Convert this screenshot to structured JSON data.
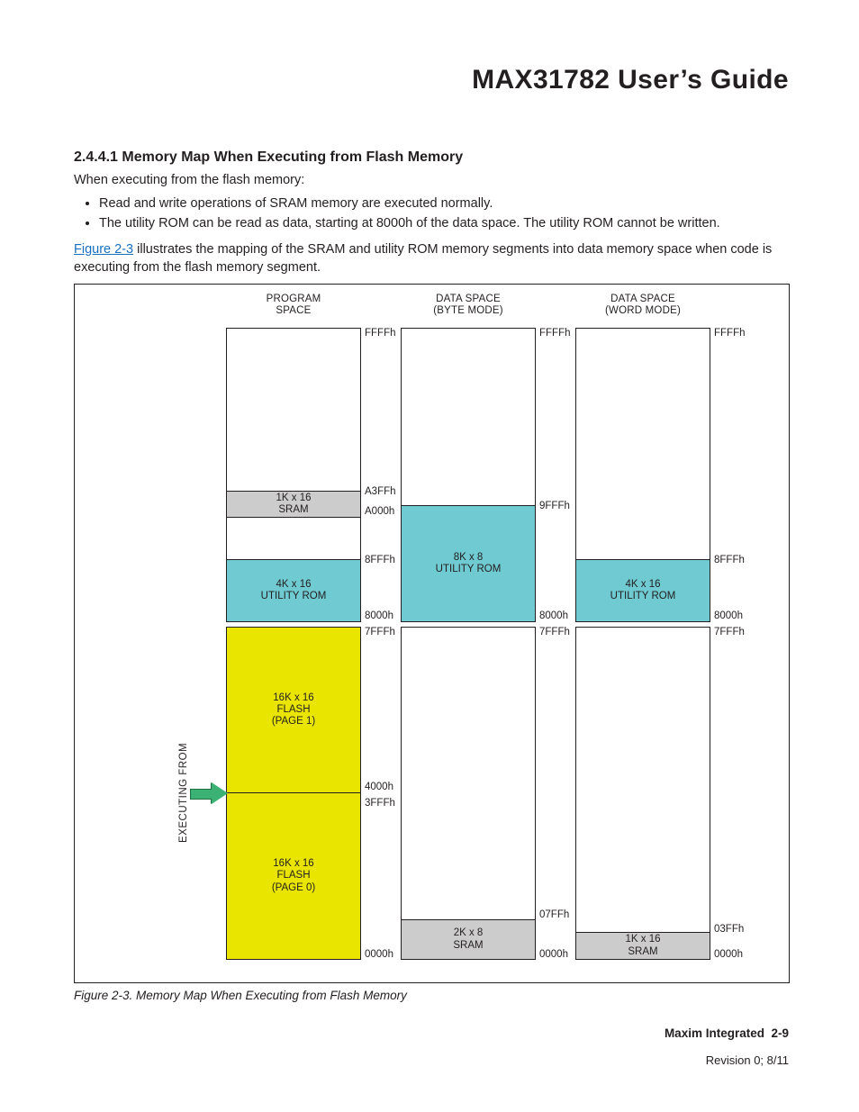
{
  "header": {
    "title": "MAX31782 User’s Guide"
  },
  "section": {
    "number": "2.4.4.1",
    "title": "Memory Map When Executing from Flash Memory",
    "intro": "When executing from the flash memory:",
    "bullets": [
      "Read and write operations of SRAM memory are executed normally.",
      "The utility ROM can be read as data, starting at 8000h of the data space. The utility ROM cannot be written."
    ],
    "para_link": "Figure 2-3",
    "para_rest": " illustrates the mapping of the SRAM and utility ROM memory segments into data memory space when code is executing from the flash memory segment."
  },
  "figure": {
    "caption": "Figure 2-3. Memory Map When Executing from Flash Memory",
    "exec_label": "EXECUTING FROM",
    "columns": {
      "prog": {
        "label_l1": "PROGRAM",
        "label_l2": "SPACE"
      },
      "byte": {
        "label_l1": "DATA SPACE",
        "label_l2": "(BYTE MODE)"
      },
      "word": {
        "label_l1": "DATA SPACE",
        "label_l2": "(WORD MODE)"
      }
    },
    "prog": {
      "addr_FFFF": "FFFFh",
      "sram_l1": "1K x 16",
      "sram_l2": "SRAM",
      "addr_A3FF": "A3FFh",
      "addr_A000": "A000h",
      "urom_l1": "4K x 16",
      "urom_l2": "UTILITY ROM",
      "addr_8FFF": "8FFFh",
      "addr_8000": "8000h",
      "addr_7FFF": "7FFFh",
      "flash1_l1": "16K x 16",
      "flash1_l2": "FLASH",
      "flash1_l3": "(PAGE 1)",
      "addr_4000": "4000h",
      "addr_3FFF": "3FFFh",
      "flash0_l1": "16K x 16",
      "flash0_l2": "FLASH",
      "flash0_l3": "(PAGE 0)",
      "addr_0000": "0000h"
    },
    "byte": {
      "addr_FFFF": "FFFFh",
      "addr_9FFF": "9FFFh",
      "urom_l1": "8K x 8",
      "urom_l2": "UTILITY ROM",
      "addr_8000": "8000h",
      "addr_7FFF": "7FFFh",
      "addr_07FF": "07FFh",
      "sram_l1": "2K x 8",
      "sram_l2": "SRAM",
      "addr_0000": "0000h"
    },
    "word": {
      "addr_FFFF": "FFFFh",
      "addr_8FFF": "8FFFh",
      "urom_l1": "4K x 16",
      "urom_l2": "UTILITY ROM",
      "addr_8000": "8000h",
      "addr_7FFF": "7FFFh",
      "addr_03FF": "03FFh",
      "sram_l1": "1K x 16",
      "sram_l2": "SRAM",
      "addr_0000": "0000h"
    }
  },
  "footer": {
    "company": "Maxim Integrated",
    "pageno": "2-9",
    "revision": "Revision 0; 8/11"
  }
}
